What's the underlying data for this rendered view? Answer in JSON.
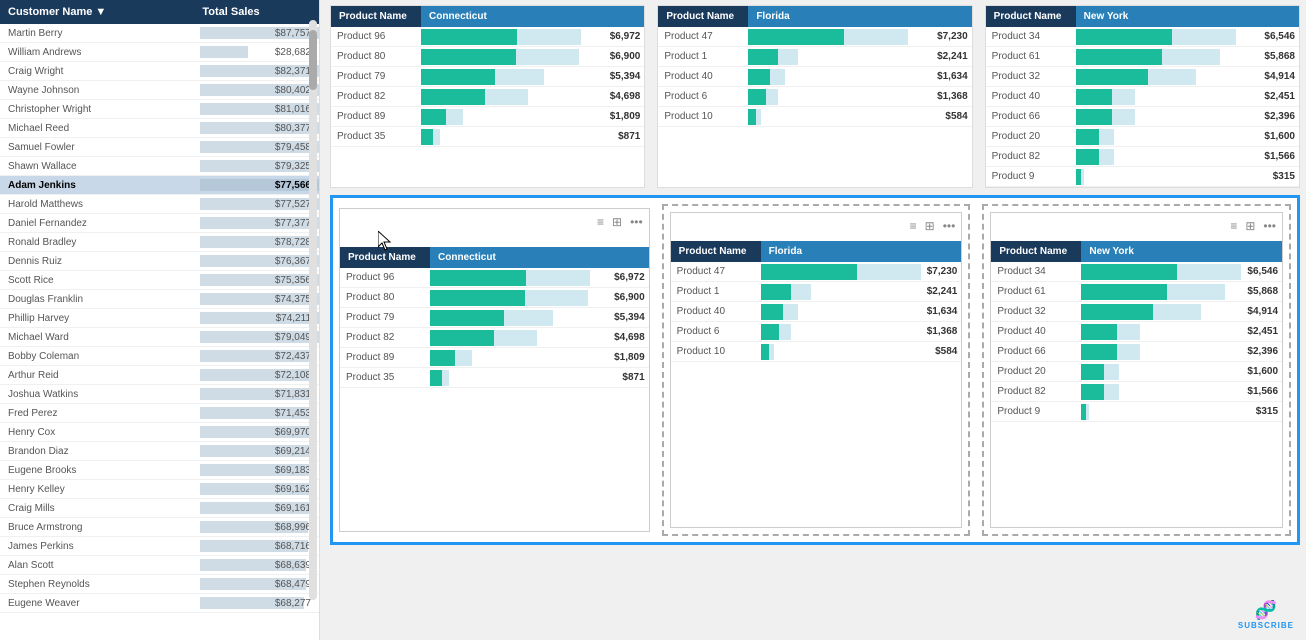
{
  "leftTable": {
    "headers": [
      "Customer Name",
      "Total Sales"
    ],
    "rows": [
      {
        "name": "Martin Berry",
        "sales": "$87,757",
        "barPct": 95
      },
      {
        "name": "William Andrews",
        "sales": "$28,682",
        "barPct": 30
      },
      {
        "name": "Craig Wright",
        "sales": "$82,371",
        "barPct": 88
      },
      {
        "name": "Wayne Johnson",
        "sales": "$80,402",
        "barPct": 85
      },
      {
        "name": "Christopher Wright",
        "sales": "$81,016",
        "barPct": 85
      },
      {
        "name": "Michael Reed",
        "sales": "$80,377",
        "barPct": 84
      },
      {
        "name": "Samuel Fowler",
        "sales": "$79,458",
        "barPct": 83
      },
      {
        "name": "Shawn Wallace",
        "sales": "$79,325",
        "barPct": 82
      },
      {
        "name": "Adam Jenkins",
        "sales": "$77,566",
        "barPct": 80,
        "highlighted": true
      },
      {
        "name": "Harold Matthews",
        "sales": "$77,527",
        "barPct": 80
      },
      {
        "name": "Daniel Fernandez",
        "sales": "$77,377",
        "barPct": 79
      },
      {
        "name": "Ronald Bradley",
        "sales": "$78,728",
        "barPct": 79
      },
      {
        "name": "Dennis Ruiz",
        "sales": "$76,367",
        "barPct": 78
      },
      {
        "name": "Scott Rice",
        "sales": "$75,356",
        "barPct": 77
      },
      {
        "name": "Douglas Franklin",
        "sales": "$74,375",
        "barPct": 76
      },
      {
        "name": "Phillip Harvey",
        "sales": "$74,211",
        "barPct": 75
      },
      {
        "name": "Michael Ward",
        "sales": "$79,049",
        "barPct": 75
      },
      {
        "name": "Bobby Coleman",
        "sales": "$72,437",
        "barPct": 73
      },
      {
        "name": "Arthur Reid",
        "sales": "$72,108",
        "barPct": 72
      },
      {
        "name": "Joshua Watkins",
        "sales": "$71,831",
        "barPct": 71
      },
      {
        "name": "Fred Perez",
        "sales": "$71,453",
        "barPct": 71
      },
      {
        "name": "Henry Cox",
        "sales": "$69,970",
        "barPct": 69
      },
      {
        "name": "Brandon Diaz",
        "sales": "$69,214",
        "barPct": 68
      },
      {
        "name": "Eugene Brooks",
        "sales": "$69,183",
        "barPct": 68
      },
      {
        "name": "Henry Kelley",
        "sales": "$69,162",
        "barPct": 68
      },
      {
        "name": "Craig Mills",
        "sales": "$69,161",
        "barPct": 68
      },
      {
        "name": "Bruce Armstrong",
        "sales": "$68,996",
        "barPct": 67
      },
      {
        "name": "James Perkins",
        "sales": "$68,716",
        "barPct": 67
      },
      {
        "name": "Alan Scott",
        "sales": "$68,639",
        "barPct": 66
      },
      {
        "name": "Stephen Reynolds",
        "sales": "$68,479",
        "barPct": 66
      },
      {
        "name": "Eugene Weaver",
        "sales": "$68,277",
        "barPct": 65
      }
    ]
  },
  "connecticutChart": {
    "header": "Connecticut",
    "colLabel": "Product Name",
    "rows": [
      {
        "name": "Product 96",
        "value": "$6,972",
        "pct": 100
      },
      {
        "name": "Product 80",
        "value": "$6,900",
        "pct": 99
      },
      {
        "name": "Product 79",
        "value": "$5,394",
        "pct": 77
      },
      {
        "name": "Product 82",
        "value": "$4,698",
        "pct": 67
      },
      {
        "name": "Product 89",
        "value": "$1,809",
        "pct": 26
      },
      {
        "name": "Product 35",
        "value": "$871",
        "pct": 12
      }
    ]
  },
  "floridaChart": {
    "header": "Florida",
    "colLabel": "Product Name",
    "rows": [
      {
        "name": "Product 47",
        "value": "$7,230",
        "pct": 100
      },
      {
        "name": "Product 1",
        "value": "$2,241",
        "pct": 31
      },
      {
        "name": "Product 40",
        "value": "$1,634",
        "pct": 23
      },
      {
        "name": "Product 6",
        "value": "$1,368",
        "pct": 19
      },
      {
        "name": "Product 10",
        "value": "$584",
        "pct": 8
      }
    ]
  },
  "newYorkChart": {
    "header": "New York",
    "colLabel": "Product Name",
    "rows": [
      {
        "name": "Product 34",
        "value": "$6,546",
        "pct": 100
      },
      {
        "name": "Product 61",
        "value": "$5,868",
        "pct": 90
      },
      {
        "name": "Product 32",
        "value": "$4,914",
        "pct": 75
      },
      {
        "name": "Product 40",
        "value": "$2,451",
        "pct": 37
      },
      {
        "name": "Product 66",
        "value": "$2,396",
        "pct": 37
      },
      {
        "name": "Product 20",
        "value": "$1,600",
        "pct": 24
      },
      {
        "name": "Product 82",
        "value": "$1,566",
        "pct": 24
      },
      {
        "name": "Product 9",
        "value": "$315",
        "pct": 5
      }
    ]
  },
  "toolbar": {
    "expandIcon": "⊞",
    "menuIcon": "≡",
    "moreIcon": "···"
  },
  "subscribe": {
    "icon": "🧬",
    "label": "SUBSCRIBE"
  }
}
